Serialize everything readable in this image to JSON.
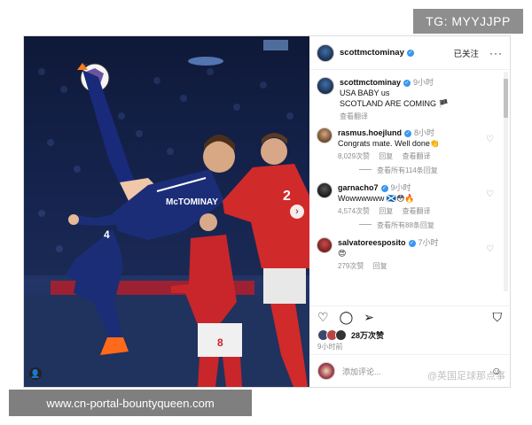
{
  "tg_tag": "TG: MYYJJPP",
  "footer_url": "www.cn-portal-bountyqueen.com",
  "watermark": "@英国足球那点事",
  "photo": {
    "jersey_name": "McTOMINAY",
    "shorts_number": "4",
    "opponent_number": "2",
    "opponent2_number": "8"
  },
  "post": {
    "author": "scottmctominay",
    "follow_label": "已关注",
    "more_label": "···",
    "caption": {
      "username": "scottmctominay",
      "time": "9小时",
      "line1": "USA BABY us",
      "line2": "SCOTLAND ARE COMING 🏴",
      "translate": "查看翻译"
    },
    "comments": [
      {
        "username": "rasmus.hoejlund",
        "time": "8小时",
        "text": "Congrats mate. Well done👏",
        "likes": "8,029次赞",
        "reply": "回复",
        "translate": "查看翻译",
        "view_replies": "查看所有114条回复"
      },
      {
        "username": "garnacho7",
        "time": "9小时",
        "text": "Wowwwwww 🏴󠁧󠁢󠁳󠁣󠁴󠁿😳🔥",
        "likes": "4,574次赞",
        "reply": "回复",
        "translate": "查看翻译",
        "view_replies": "查看所有88条回复"
      },
      {
        "username": "salvatoreesposito",
        "time": "7小时",
        "text": "😍",
        "likes": "279次赞",
        "reply": "回复",
        "translate": "",
        "view_replies": ""
      }
    ],
    "likes_total": "28万次赞",
    "post_time": "9小时前",
    "add_comment_placeholder": "添加评论..."
  }
}
